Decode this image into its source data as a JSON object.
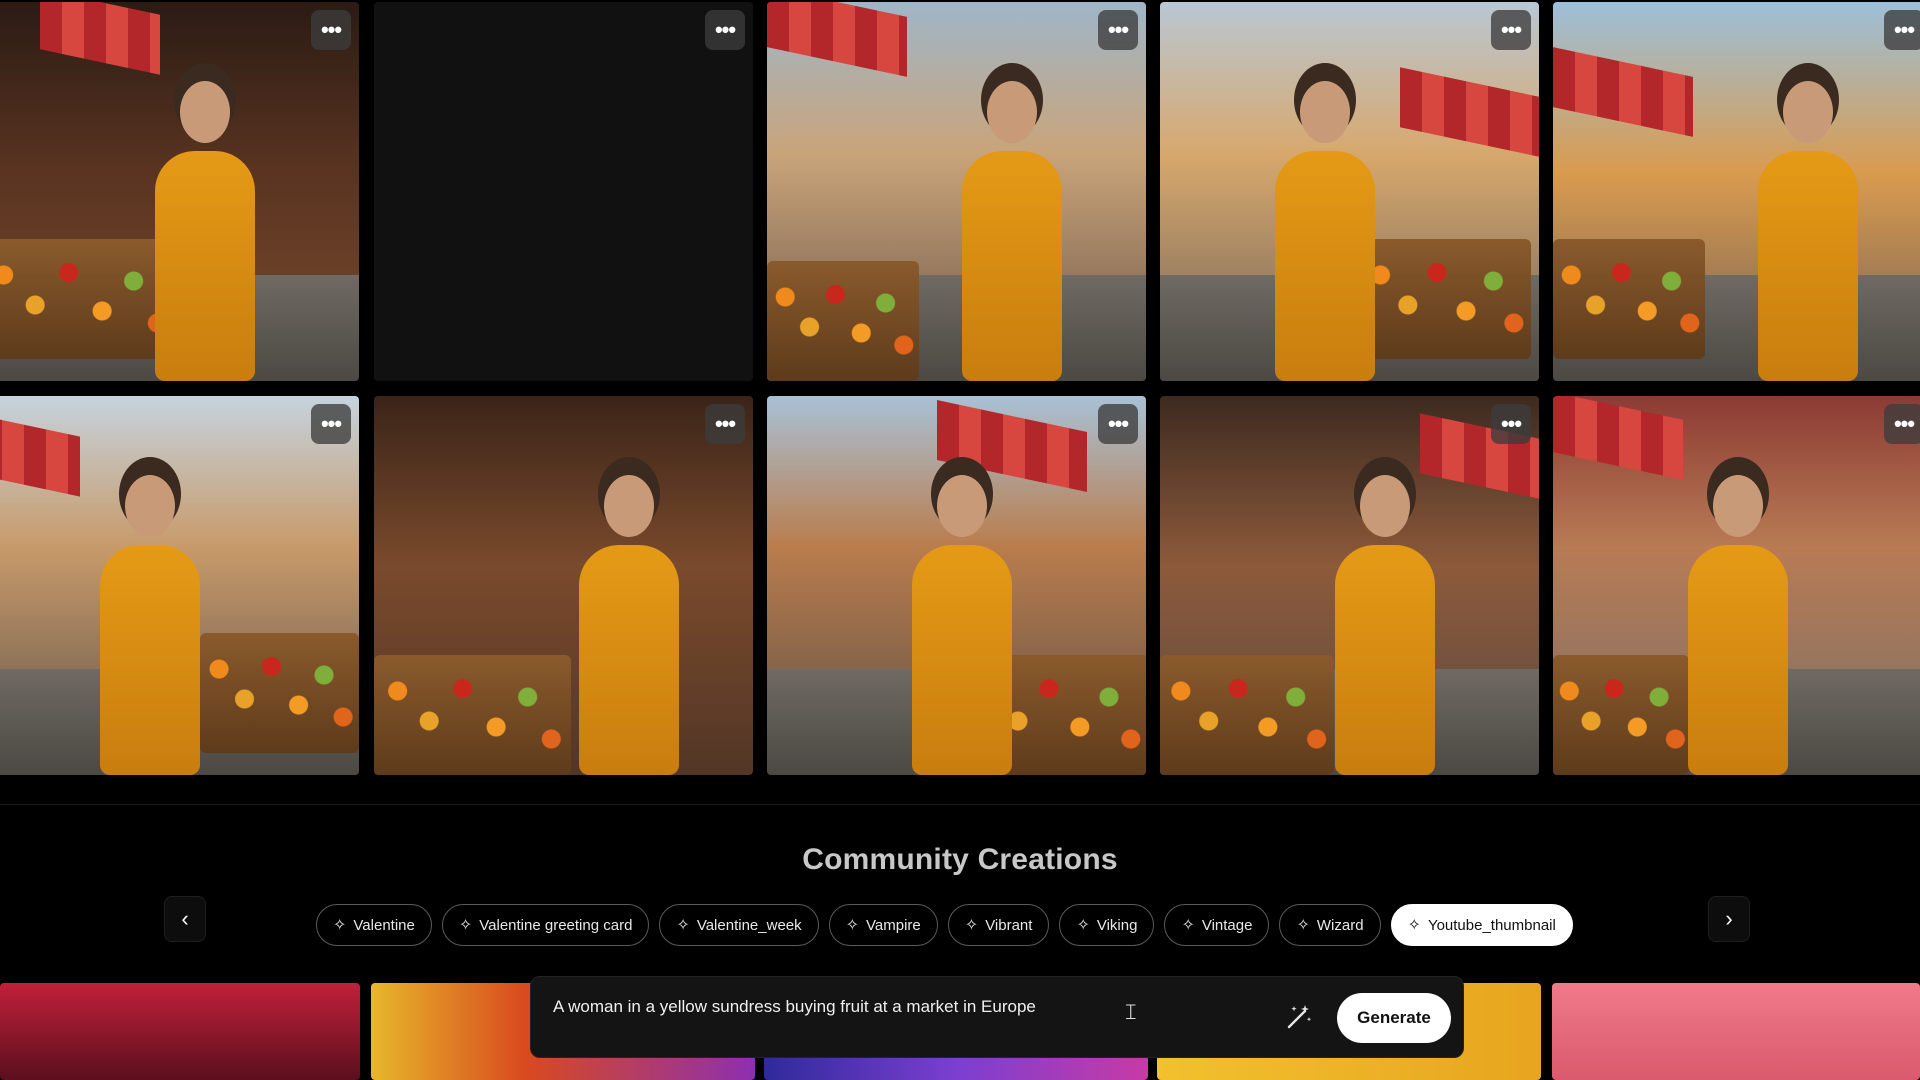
{
  "grid": {
    "more_label": "•••"
  },
  "section": {
    "title": "Community Creations"
  },
  "nav": {
    "prev_icon": "chevron-left-icon",
    "next_icon": "chevron-right-icon",
    "prev_glyph": "‹",
    "next_glyph": "›"
  },
  "chips": [
    {
      "label": "Valentine",
      "icon": "sparkle-icon",
      "active": false
    },
    {
      "label": "Valentine greeting card",
      "icon": "sparkle-icon",
      "active": false
    },
    {
      "label": "Valentine_week",
      "icon": "sparkle-icon",
      "active": false
    },
    {
      "label": "Vampire",
      "icon": "sparkle-icon",
      "active": false
    },
    {
      "label": "Vibrant",
      "icon": "sparkle-icon",
      "active": false
    },
    {
      "label": "Viking",
      "icon": "sparkle-icon",
      "active": false
    },
    {
      "label": "Vintage",
      "icon": "sparkle-icon",
      "active": false
    },
    {
      "label": "Wizard",
      "icon": "sparkle-icon",
      "active": false
    },
    {
      "label": "Youtube_thumbnail",
      "icon": "sparkle-icon",
      "active": true
    }
  ],
  "prompt": {
    "text": "A woman in a yellow sundress buying fruit at a market in Europe",
    "generate_label": "Generate",
    "magic_icon": "magic-wand-icon",
    "cursor_icon": "text-cursor-icon"
  },
  "colors": {
    "background": "#000000",
    "dress": "#e59a16",
    "awning_red": "#b3262a",
    "chip_active_bg": "#ffffff"
  }
}
